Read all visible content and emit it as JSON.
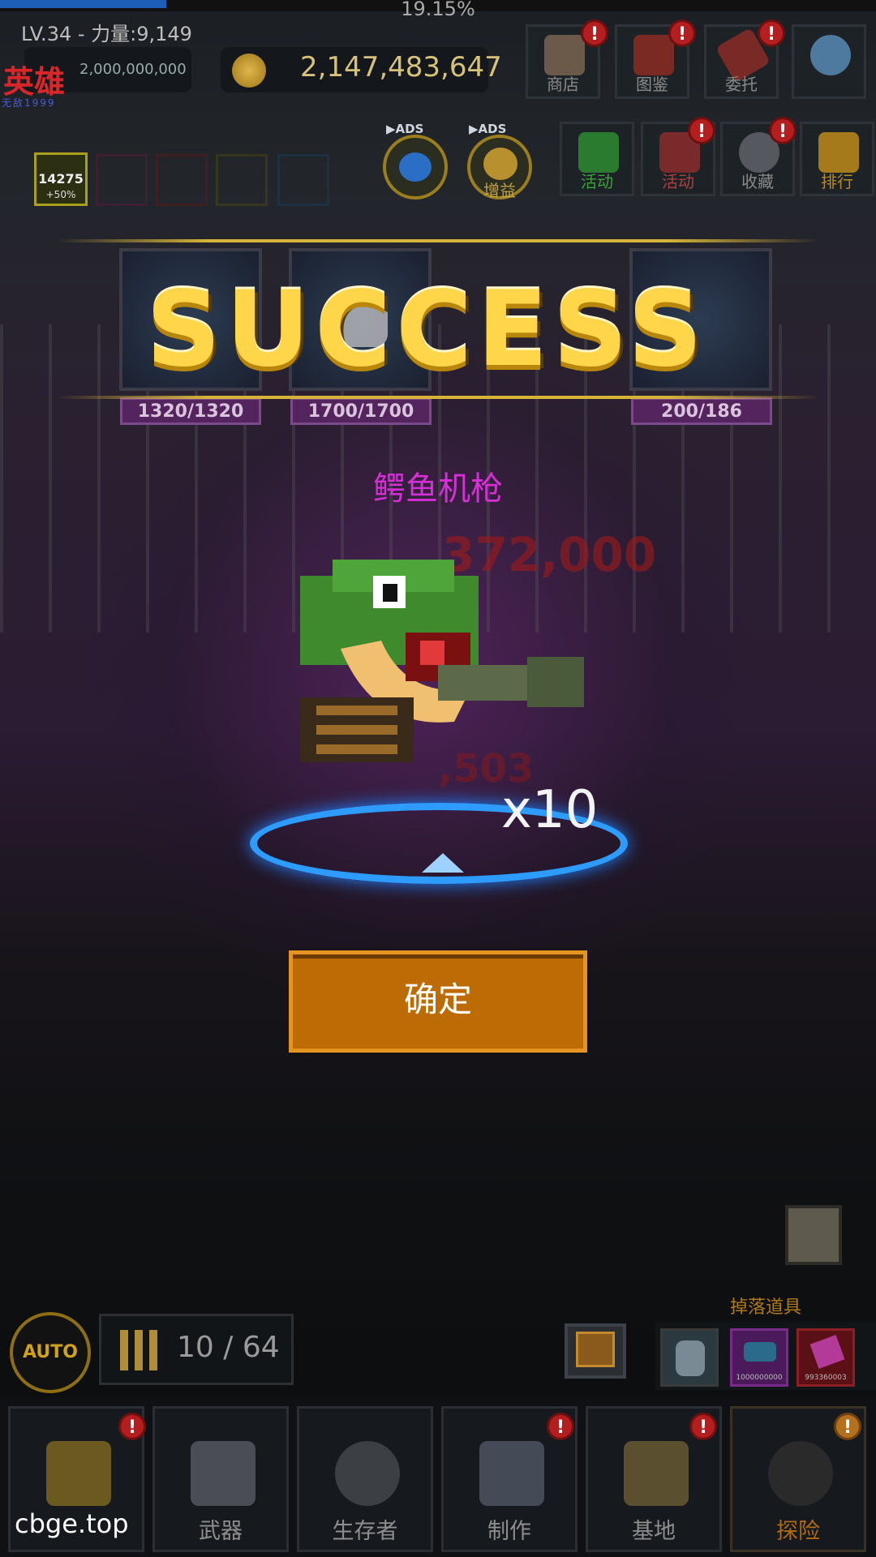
{
  "hud": {
    "xp_percent": "19.15%",
    "xp_fraction": 0.19,
    "level_text": "LV.34 - 力量:9,149",
    "logo": "英雄",
    "logo_sub": "无敌1999",
    "gems": "2,000,000,000",
    "gold": "2,147,483,647"
  },
  "top_buttons": [
    {
      "label": "商店",
      "icon": "bag-icon",
      "alert": true
    },
    {
      "label": "图鉴",
      "icon": "book-icon",
      "alert": true
    },
    {
      "label": "委托",
      "icon": "scroll-icon",
      "alert": true
    },
    {
      "label": "",
      "icon": "gear-icon",
      "alert": false
    }
  ],
  "event_buttons": [
    {
      "label": "活动",
      "icon": "gift-icon",
      "alert": false
    },
    {
      "label": "活动",
      "icon": "event-icon",
      "alert": true
    },
    {
      "label": "收藏",
      "icon": "skull-icon",
      "alert": true
    },
    {
      "label": "排行",
      "icon": "trophy-icon",
      "alert": false
    }
  ],
  "ad_buttons": [
    {
      "tag": "ADS",
      "label": "",
      "icon": "gem-coin-icon"
    },
    {
      "tag": "ADS",
      "label": "增益",
      "icon": "coins-icon"
    }
  ],
  "buff": {
    "value": "14275",
    "bonus": "+50%"
  },
  "reward_cards": [
    {
      "count": "1320/1320"
    },
    {
      "count": "1700/1700"
    },
    {
      "count": "200/186"
    }
  ],
  "result": {
    "title": "SUCCESS",
    "item_name": "鳄鱼机枪",
    "quantity": "x10",
    "confirm_label": "确定"
  },
  "battle_text": {
    "damage_1": "372,000",
    "damage_2": ",503"
  },
  "drops": {
    "label": "掉落道具",
    "items": [
      {
        "icon": "shark-icon",
        "count": ""
      },
      {
        "icon": "shoe-icon",
        "count": "1000000000"
      },
      {
        "icon": "ticket-icon",
        "count": "993360003"
      }
    ]
  },
  "auto_label": "AUTO",
  "ammo": "10 / 64",
  "nav": [
    {
      "label": "",
      "icon": "upgrade-icon",
      "alert": true
    },
    {
      "label": "武器",
      "icon": "revolver-icon",
      "alert": false
    },
    {
      "label": "生存者",
      "icon": "gasmask-icon",
      "alert": false
    },
    {
      "label": "制作",
      "icon": "craft-icon",
      "alert": true
    },
    {
      "label": "基地",
      "icon": "base-icon",
      "alert": true
    },
    {
      "label": "探险",
      "icon": "explore-icon",
      "alert": true,
      "active": true
    }
  ],
  "watermark": "cbge.top"
}
